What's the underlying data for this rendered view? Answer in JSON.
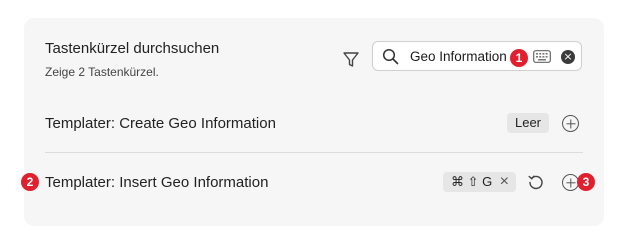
{
  "header": {
    "title": "Tastenkürzel durchsuchen",
    "subtitle": "Zeige 2 Tastenkürzel."
  },
  "search": {
    "value": "Geo Information",
    "icon": "search-icon"
  },
  "badges": [
    "1",
    "2",
    "3"
  ],
  "rows": [
    {
      "label": "Templater: Create Geo Information",
      "hotkey": "Leer"
    },
    {
      "label": "Templater: Insert Geo Information",
      "hotkey_keys": "⌘ ⇧ G",
      "remove_glyph": "×"
    }
  ],
  "icons": {
    "filter": "filter-icon",
    "keyboard": "keyboard-icon",
    "clear": "clear-search-icon",
    "add": "plus-circle-icon",
    "reset": "restore-icon"
  }
}
